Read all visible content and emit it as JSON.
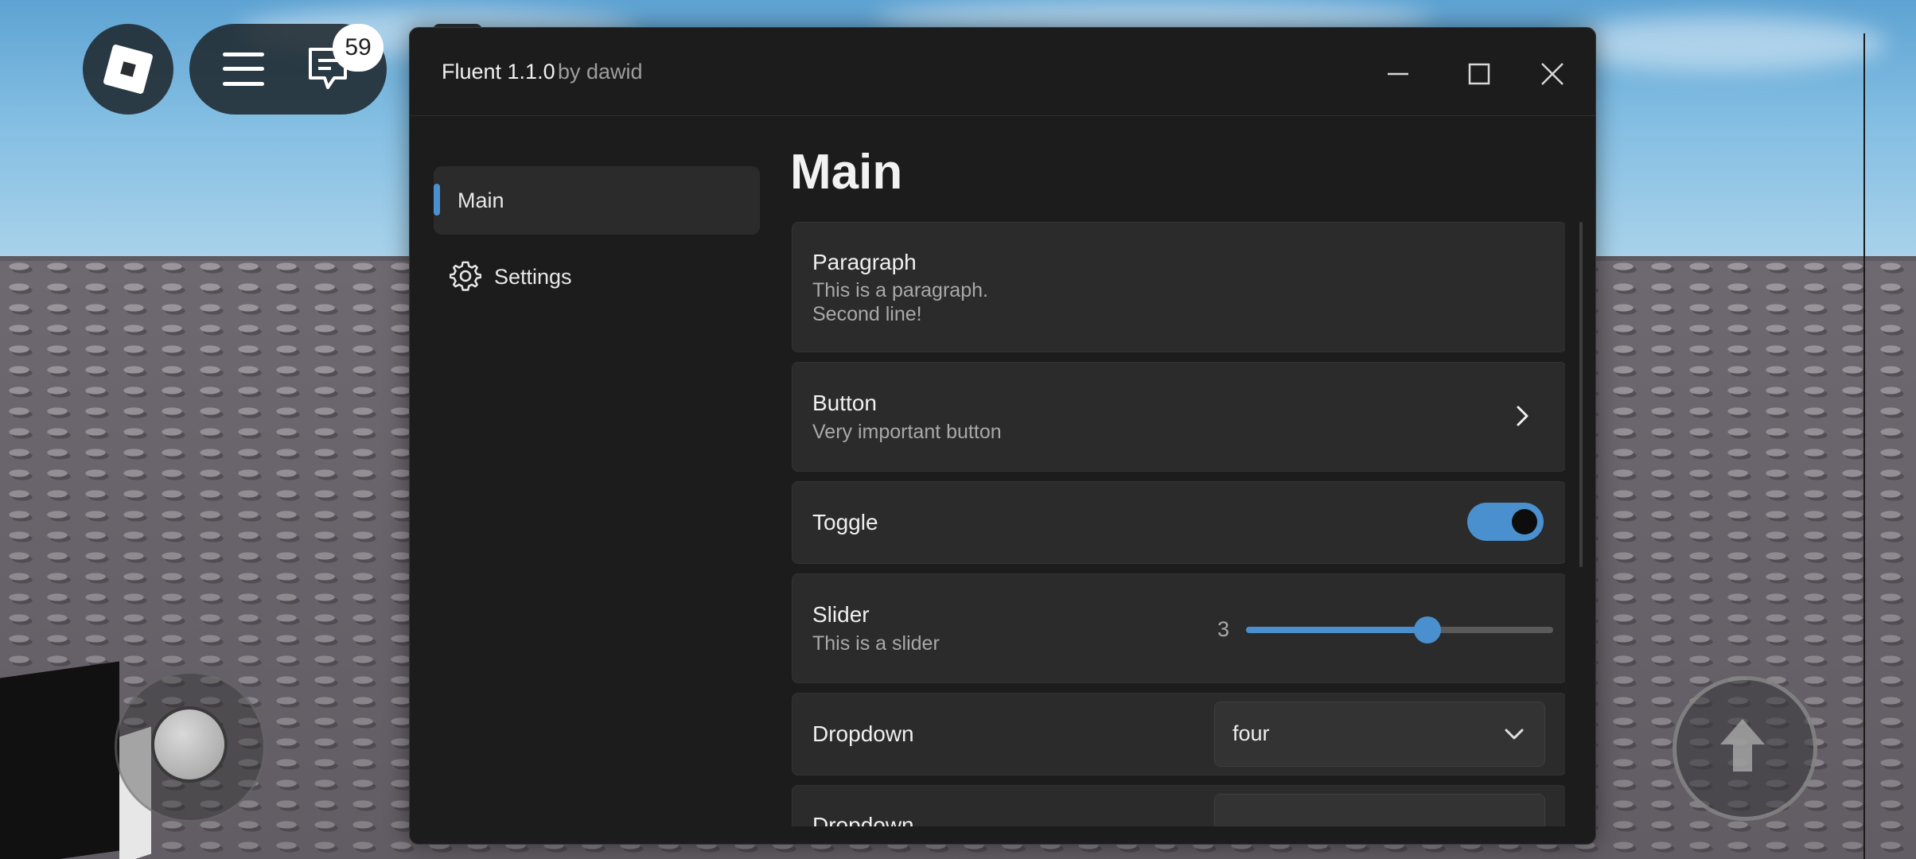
{
  "hud": {
    "chat_badge_count": "59"
  },
  "window": {
    "title": "Fluent 1.1.0",
    "subtitle": "by dawid"
  },
  "sidebar": {
    "items": [
      {
        "label": "Main",
        "icon": "none",
        "active": true
      },
      {
        "label": "Settings",
        "icon": "gear-icon",
        "active": false
      }
    ]
  },
  "main": {
    "page_title": "Main",
    "paragraph": {
      "title": "Paragraph",
      "line1": "This is a paragraph.",
      "line2": "Second line!"
    },
    "button": {
      "title": "Button",
      "description": "Very important button",
      "icon": "chevron-right-icon"
    },
    "toggle": {
      "title": "Toggle",
      "enabled": true
    },
    "slider": {
      "title": "Slider",
      "description": "This is a slider",
      "value": "3",
      "fill_fraction": 0.59
    },
    "dropdown": {
      "title": "Dropdown",
      "selected": "four",
      "icon": "chevron-down-icon"
    },
    "dropdown2": {
      "title": "Dropdown"
    }
  },
  "colors": {
    "accent": "#4a90cf",
    "window_bg": "#1c1c1c",
    "card_bg": "#2b2b2b"
  }
}
